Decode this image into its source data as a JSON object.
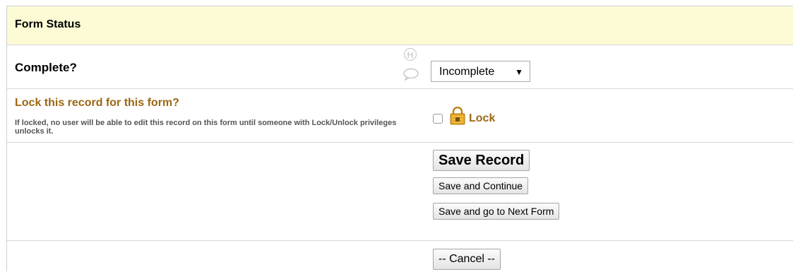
{
  "form_status": {
    "title": "Form Status"
  },
  "complete": {
    "label": "Complete?",
    "help_icon_text": "H",
    "select_value": "Incomplete",
    "select_arrow": "▼"
  },
  "lock": {
    "label": "Lock this record for this form?",
    "note": "If locked, no user will be able to edit this record on this form until someone with Lock/Unlock privileges unlocks it.",
    "checkbox_checked": false,
    "lock_text": "Lock"
  },
  "buttons": {
    "save_record": "Save Record",
    "save_continue": "Save and Continue",
    "save_next_form": "Save and go to Next Form",
    "cancel": "-- Cancel --"
  },
  "colors": {
    "header_bg": "#fdfbd6",
    "lock_label": "#9b6612",
    "lock_icon": "#e8a825"
  }
}
